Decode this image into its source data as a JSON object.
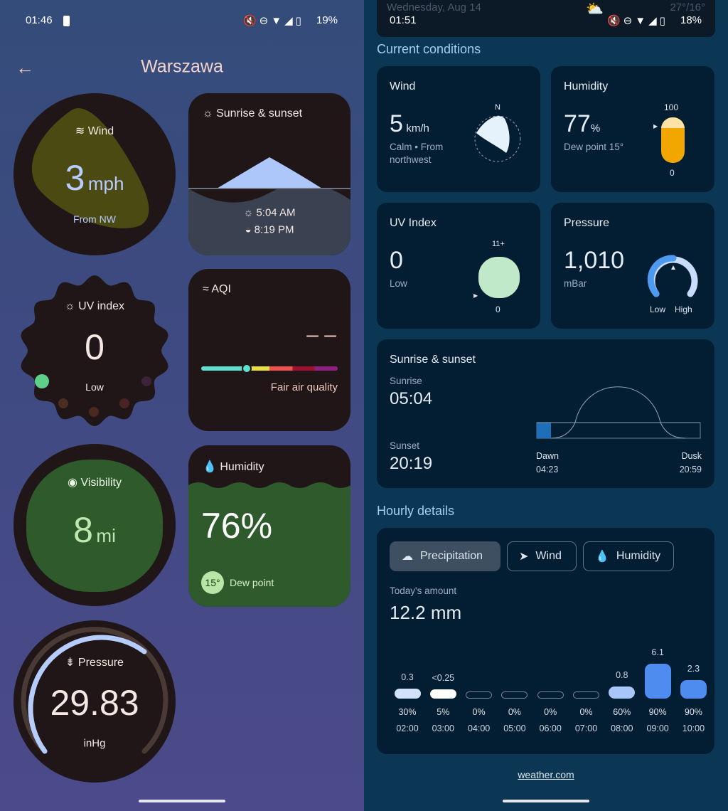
{
  "left": {
    "status": {
      "time": "01:46",
      "battery": "19%"
    },
    "title": "Warszawa",
    "wind": {
      "label": "Wind",
      "value": "3",
      "unit": "mph",
      "direction": "From NW"
    },
    "sun": {
      "label": "Sunrise & sunset",
      "sunrise": "5:04 AM",
      "sunset": "8:19 PM"
    },
    "uv": {
      "label": "UV index",
      "value": "0",
      "level": "Low"
    },
    "aqi": {
      "label": "AQI",
      "value": "– –",
      "quality": "Fair air quality",
      "level_fraction": 0.25
    },
    "visibility": {
      "label": "Visibility",
      "value": "8",
      "unit": "mi"
    },
    "humidity": {
      "label": "Humidity",
      "value": "76%",
      "dew_value": "15°",
      "dew_label": "Dew point"
    },
    "pressure": {
      "label": "Pressure",
      "value": "29.83",
      "unit": "inHg"
    }
  },
  "right": {
    "status": {
      "date": "Wednesday, Aug 14",
      "temps": "27°/16°",
      "time": "01:51",
      "battery": "18%"
    },
    "current_heading": "Current conditions",
    "wind": {
      "label": "Wind",
      "value": "5",
      "unit": "km/h",
      "desc1": "Calm • From",
      "desc2": "northwest",
      "compass": "N"
    },
    "humidity": {
      "label": "Humidity",
      "value": "77",
      "unit": "%",
      "dew": "Dew point 15°",
      "max": "100",
      "min": "0",
      "fraction": 0.77
    },
    "uv": {
      "label": "UV Index",
      "value": "0",
      "level": "Low",
      "max": "11+",
      "min": "0"
    },
    "pressure": {
      "label": "Pressure",
      "value": "1,010",
      "unit": "mBar",
      "low": "Low",
      "high": "High"
    },
    "sun": {
      "label": "Sunrise & sunset",
      "sunrise_label": "Sunrise",
      "sunrise": "05:04",
      "sunset_label": "Sunset",
      "sunset": "20:19",
      "dawn_label": "Dawn",
      "dawn": "04:23",
      "dusk_label": "Dusk",
      "dusk": "20:59"
    },
    "hourly_heading": "Hourly details",
    "tabs": [
      {
        "label": "Precipitation",
        "icon": "rain-cloud-icon"
      },
      {
        "label": "Wind",
        "icon": "navigation-arrow-icon"
      },
      {
        "label": "Humidity",
        "icon": "droplet-icon"
      }
    ],
    "today_label": "Today's amount",
    "today_value": "12.2 mm",
    "hours": [
      {
        "time": "02:00",
        "amount": "0.3",
        "amount_num": 0.3,
        "chance": "30%",
        "color": "#d3e2fb"
      },
      {
        "time": "03:00",
        "amount": "<0.25",
        "amount_num": 0.25,
        "chance": "5%",
        "color": "#ffffff"
      },
      {
        "time": "04:00",
        "amount": "",
        "amount_num": 0,
        "chance": "0%",
        "color": ""
      },
      {
        "time": "05:00",
        "amount": "",
        "amount_num": 0,
        "chance": "0%",
        "color": ""
      },
      {
        "time": "06:00",
        "amount": "",
        "amount_num": 0,
        "chance": "0%",
        "color": ""
      },
      {
        "time": "07:00",
        "amount": "",
        "amount_num": 0,
        "chance": "0%",
        "color": ""
      },
      {
        "time": "08:00",
        "amount": "0.8",
        "amount_num": 0.8,
        "chance": "60%",
        "color": "#a9c6f8"
      },
      {
        "time": "09:00",
        "amount": "6.1",
        "amount_num": 6.1,
        "chance": "90%",
        "color": "#4e8cf0"
      },
      {
        "time": "10:00",
        "amount": "2.3",
        "amount_num": 2.3,
        "chance": "90%",
        "color": "#4e8cf0"
      }
    ],
    "source_link": "weather.com"
  }
}
